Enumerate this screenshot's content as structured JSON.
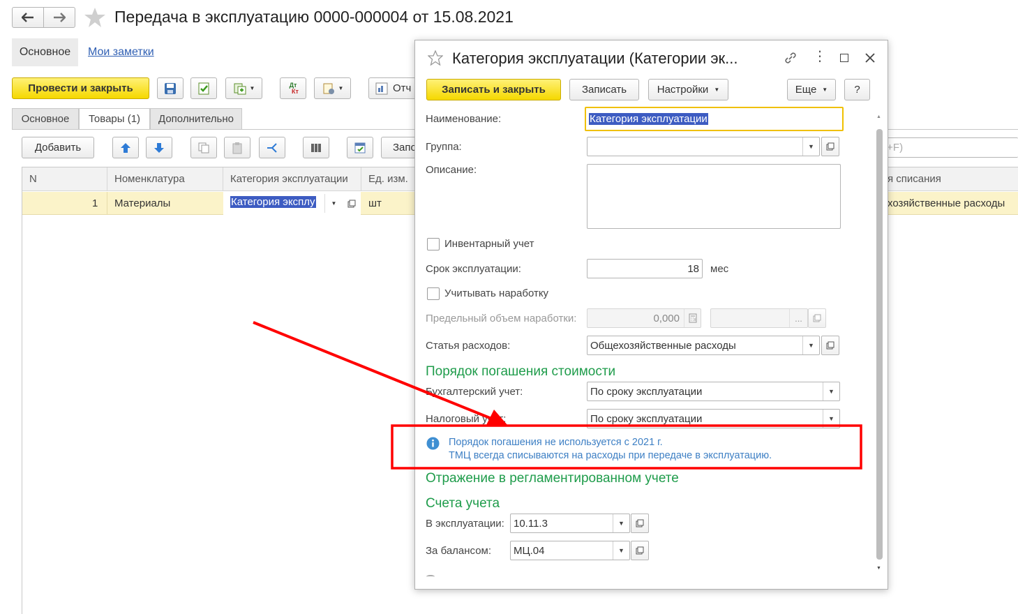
{
  "doc": {
    "title": "Передача в эксплуатацию 0000-000004 от 15.08.2021",
    "nav_main": "Основное",
    "nav_notes": "Мои заметки",
    "post_close": "Провести и закрыть",
    "reports_partial": "Отч",
    "tabs": [
      "Основное",
      "Товары (1)",
      "Дополнительно"
    ],
    "add_button": "Добавить",
    "fill_partial": "Запо",
    "search_hint_partial": "I+F)",
    "columns": [
      "N",
      "Номенклатура",
      "Категория эксплуатации",
      "Ед. изм.",
      "я списания"
    ],
    "row": {
      "n": "1",
      "item": "Материалы",
      "category": "Категория эксплу",
      "unit": "шт",
      "writeoff": "хозяйственные расходы"
    },
    "dtkt_top": "Дт",
    "dtkt_bottom": "Кт"
  },
  "dialog": {
    "title": "Категория эксплуатации (Категории эк...",
    "save_close": "Записать и закрыть",
    "save": "Записать",
    "settings": "Настройки",
    "more": "Еще",
    "help": "?",
    "name_label": "Наименование:",
    "name_value": "Категория эксплуатации",
    "group_label": "Группа:",
    "group_value": "",
    "desc_label": "Описание:",
    "inventory_label": "Инвентарный учет",
    "inventory_checked": false,
    "term_label": "Срок эксплуатации:",
    "term_value": "18",
    "term_unit": "мес",
    "runtime_label": "Учитывать наработку",
    "runtime_checked": false,
    "limit_label": "Предельный объем наработки:",
    "limit_value": "0,000",
    "limit_ellipsis": "...",
    "expense_label": "Статья расходов:",
    "expense_value": "Общехозяйственные расходы",
    "section_repay": "Порядок погашения стоимости",
    "acc_label": "Бухгалтерский учет:",
    "acc_value": "По сроку эксплуатации",
    "tax_label": "Налоговый учет:",
    "tax_value": "По сроку эксплуатации",
    "info_line1": "Порядок погашения не используется с 2021 г.",
    "info_line2": "ТМЦ всегда списываются на расходы при передаче в эксплуатацию.",
    "section_reg": "Отражение в регламентированном учете",
    "section_accounts": "Счета учета",
    "in_use_label": "В эксплуатации:",
    "in_use_value": "10.11.3",
    "offbal_label": "За балансом:",
    "offbal_value": "МЦ.04"
  },
  "colors": {
    "accent_yellow": "#f5d800",
    "section_green": "#1f9c4b",
    "link_blue": "#2f5fb3",
    "highlight_red": "#ff0000",
    "selection": "#3d5cc2",
    "row_yellow": "#fbf3c9"
  }
}
